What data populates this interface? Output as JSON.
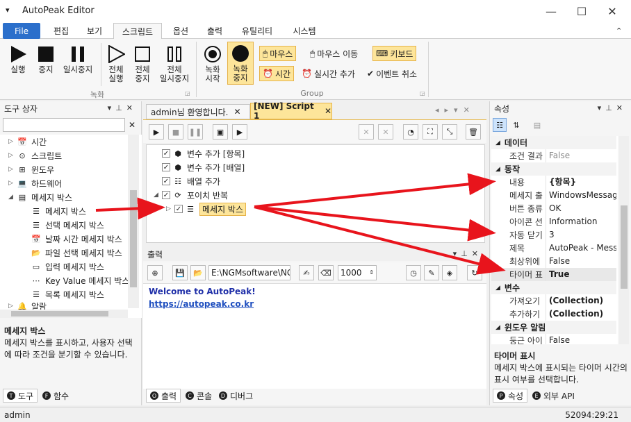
{
  "window": {
    "title": "AutoPeak Editor",
    "min": "—",
    "max": "☐",
    "close": "✕",
    "quick": "▾"
  },
  "menu": [
    "File",
    "편집",
    "보기",
    "스크립트",
    "옵션",
    "출력",
    "유틸리티",
    "시스템"
  ],
  "ribbon": {
    "rec_group": "녹화",
    "group_label": "Group",
    "run": "실행",
    "stop": "중지",
    "pause": "일시중지",
    "all_run": [
      "전체",
      "실행"
    ],
    "all_stop": [
      "전체",
      "중지"
    ],
    "all_pause": [
      "전체",
      "일시중지"
    ],
    "rec_start": [
      "녹화",
      "시작"
    ],
    "rec_stop": [
      "녹화",
      "중지"
    ],
    "mouse": "마우스",
    "mouse_move": "마우스 이동",
    "keyboard": "키보드",
    "time": "시간",
    "realtime_add": "실시간 추가",
    "event_cancel": "이벤트 취소"
  },
  "toolbox": {
    "title": "도구 상자",
    "items": [
      "시간",
      "스크립트",
      "윈도우",
      "하드웨어",
      "메세지 박스",
      "메세지 박스",
      "선택 메세지 박스",
      "날짜 시간 메세지 박스",
      "파일 선택 메세지 박스",
      "입력 메세지 박스",
      "Key Value 메세지 박스",
      "목록 메세지 박스",
      "알람"
    ],
    "desc_title": "메세지 박스",
    "desc": "메세지 박스를 표시하고, 사용자 선택에 따라 조건을 분기할 수 있습니다.",
    "tabs": [
      "도구",
      "함수"
    ],
    "tab_icons": [
      "T",
      "F"
    ]
  },
  "editor": {
    "tabs": [
      "admin님 환영합니다.",
      "[NEW] Script 1"
    ],
    "nodes": [
      "변수 추가 [항목]",
      "변수 추가 [배열]",
      "배열 추가",
      "포이치 반복",
      "메세지 박스"
    ]
  },
  "output": {
    "title": "출력",
    "path": "E:\\NGMsoftware\\NG",
    "count": "1000",
    "welcome": "Welcome to AutoPeak!",
    "link": "https://autopeak.co.kr",
    "tabs": [
      "출력",
      "콘솔",
      "디버그"
    ],
    "tab_icons": [
      "O",
      "C",
      "D"
    ]
  },
  "props": {
    "title": "속성",
    "rows": [
      {
        "cat": "데이터"
      },
      {
        "n": "조건 결과",
        "v": "False",
        "gray": true
      },
      {
        "cat": "동작"
      },
      {
        "n": "내용",
        "v": "{항목}",
        "bold": true
      },
      {
        "n": "메세지 출",
        "v": "WindowsMessage"
      },
      {
        "n": "버튼 종류",
        "v": "OK"
      },
      {
        "n": "아이콘 선",
        "v": "Information"
      },
      {
        "n": "자동 닫기",
        "v": "3"
      },
      {
        "n": "제목",
        "v": "AutoPeak - Messa"
      },
      {
        "n": "최상위에",
        "v": "False"
      },
      {
        "n": "타이머 표",
        "v": "True",
        "bold": true,
        "sel": true
      },
      {
        "cat": "변수"
      },
      {
        "n": "가져오기",
        "v": "(Collection)",
        "bold": true
      },
      {
        "n": "추가하기",
        "v": "(Collection)",
        "bold": true
      },
      {
        "cat": "윈도우 알림"
      },
      {
        "n": "둥근 아이",
        "v": "False"
      }
    ],
    "desc_title": "타이머 표시",
    "desc": "메세지 박스에 표시되는 타이머 시간의 표시 여부를 선택합니다.",
    "tabs": [
      "속성",
      "외부 API"
    ],
    "tab_icons": [
      "P",
      "E"
    ]
  },
  "status": {
    "user": "admin",
    "time": "52094:29:21"
  },
  "colors": {
    "accent": "#2b6fcb",
    "highlight": "#fde59a",
    "arrow": "#e8141c",
    "link": "#1f4fbf"
  }
}
